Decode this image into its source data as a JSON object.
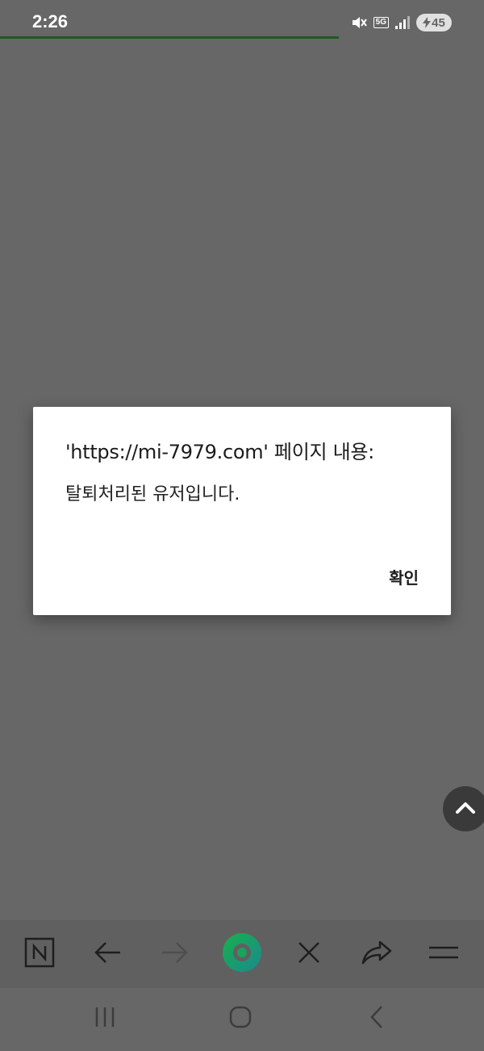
{
  "status_bar": {
    "time": "2:26",
    "network": "5G",
    "battery": "45",
    "icons": [
      "mute-icon",
      "5g-icon",
      "signal-icon",
      "battery-charging-icon"
    ]
  },
  "colors": {
    "background": "#676767",
    "loading_bar": "#1f5a22",
    "dialog_bg": "#ffffff",
    "whale_green": "#1aa35c"
  },
  "dialog": {
    "title": "'https://mi-7979.com' 페이지 내용:",
    "message": "탈퇴처리된 유저입니다.",
    "ok_label": "확인"
  },
  "toolbar": {
    "items": [
      "naver-home-icon",
      "back-arrow-icon",
      "forward-arrow-icon",
      "whale-icon",
      "close-icon",
      "share-icon",
      "menu-icon"
    ]
  },
  "navbar": {
    "items": [
      "recent-apps-icon",
      "home-icon",
      "back-icon"
    ]
  },
  "scroll_top": {
    "icon": "chevron-up-icon"
  }
}
